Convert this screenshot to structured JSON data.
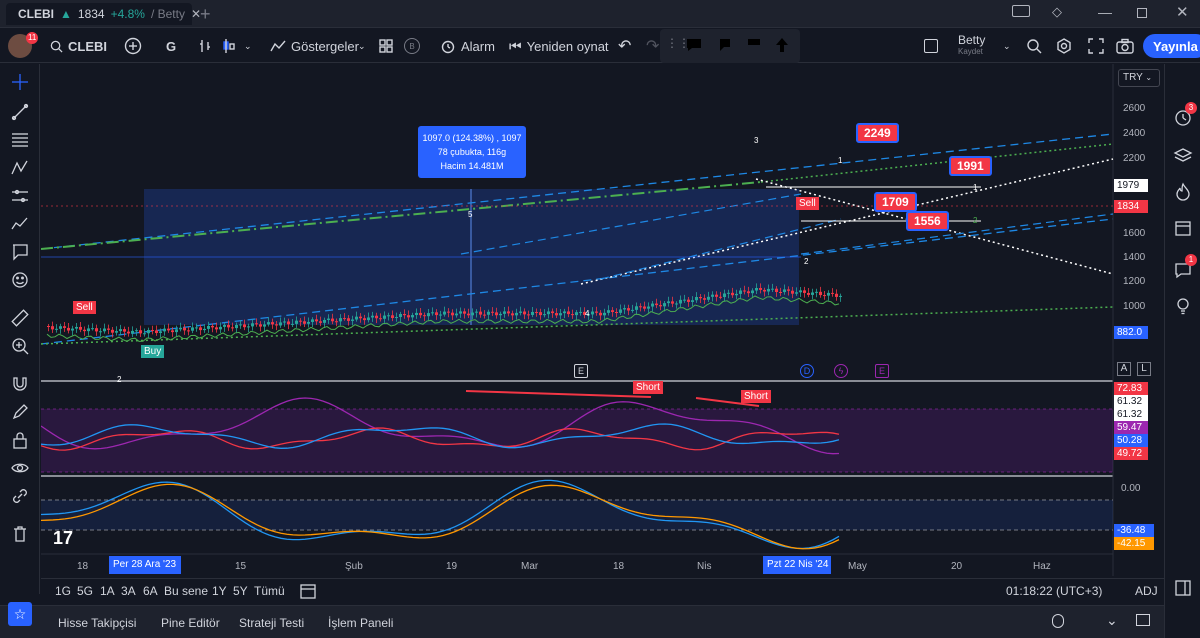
{
  "tab": {
    "symbol": "CLEBI",
    "price": "1834",
    "change": "+4.8%",
    "user_suffix": "/ Betty"
  },
  "toolbar": {
    "avatar_badge": "11",
    "symbol": "CLEBI",
    "interval": "G",
    "indicators": "Göstergeler",
    "alert": "Alarm",
    "replay": "Yeniden oynat",
    "layout_name": "Betty",
    "layout_status": "Kaydet",
    "publish": "Yayınla"
  },
  "chart": {
    "currency": "TRY",
    "price_ticks": [
      "2600",
      "2400",
      "2200",
      "1979",
      "1834",
      "1600",
      "1400",
      "1200",
      "1000",
      "882.0"
    ],
    "osc_labels": [
      "72.83",
      "61.32",
      "61.32",
      "59.47",
      "50.28",
      "49.72"
    ],
    "stoch_labels": [
      "0.00",
      "-36.48",
      "-42.15"
    ],
    "measure_box": {
      "line1": "1097.0 (124.38%) , 1097",
      "line2": "78 çubukta, 116g",
      "line3": "Hacim 14.481M"
    },
    "callouts": [
      "2249",
      "1991",
      "1709",
      "1556"
    ],
    "signals": {
      "sell": "Sell",
      "buy": "Buy",
      "short": "Short"
    },
    "events": [
      "E",
      "D",
      "E"
    ],
    "wave_numbers": [
      "3",
      "1",
      "1",
      "5",
      "4",
      "2",
      "2",
      "2"
    ],
    "date_ticks": [
      "18",
      "15",
      "Şub",
      "19",
      "Mar",
      "18",
      "Nis",
      "May",
      "20",
      "Haz"
    ],
    "date_highlight_left": "Per 28 Ara '23",
    "date_highlight_right": "Pzt 22 Nis '24",
    "colors": {
      "up": "#26a69a",
      "down": "#f23645",
      "accent": "#2962ff",
      "rsi": "#9c27b0"
    }
  },
  "bottombar": {
    "ranges": [
      "1G",
      "5G",
      "1A",
      "3A",
      "6A",
      "Bu sene",
      "1Y",
      "5Y",
      "Tümü"
    ],
    "clock": "01:18:22 (UTC+3)",
    "adj": "ADJ"
  },
  "panelbar": {
    "items": [
      "Hisse Takipçisi",
      "Pine Editör",
      "Strateji Testi",
      "İşlem Paneli"
    ]
  },
  "righticons": {
    "badge_alerts": "3",
    "badge_chat": "1"
  }
}
